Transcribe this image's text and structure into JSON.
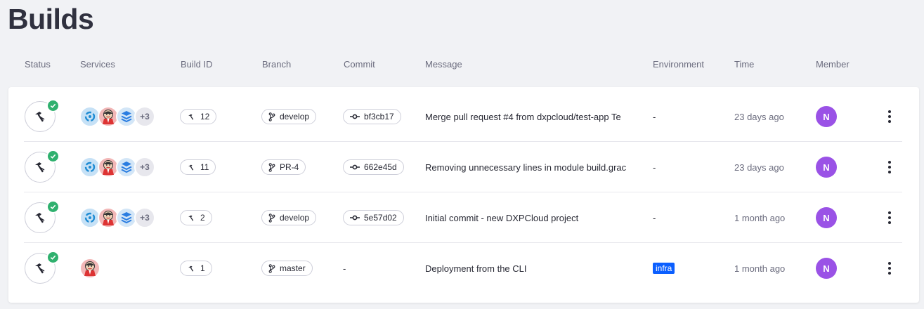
{
  "page": {
    "title": "Builds"
  },
  "columns": [
    "Status",
    "Services",
    "Build ID",
    "Branch",
    "Commit",
    "Message",
    "Environment",
    "Time",
    "Member"
  ],
  "colors": {
    "success": "#2fb06e",
    "avatar": "#9a52e6",
    "tag": "#0b5fff"
  },
  "builds": [
    {
      "status": "success",
      "services": [
        "liferay-icon",
        "jenkins-icon",
        "database-icon"
      ],
      "services_more": "+3",
      "build_id": "12",
      "branch": "develop",
      "commit": "bf3cb17",
      "message": "Merge pull request #4 from dxpcloud/test-app Te",
      "environment": "-",
      "time": "23 days ago",
      "member": "N"
    },
    {
      "status": "success",
      "services": [
        "liferay-icon",
        "jenkins-icon",
        "database-icon"
      ],
      "services_more": "+3",
      "build_id": "11",
      "branch": "PR-4",
      "commit": "662e45d",
      "message": "Removing unnecessary lines in module build.grac",
      "environment": "-",
      "time": "23 days ago",
      "member": "N"
    },
    {
      "status": "success",
      "services": [
        "liferay-icon",
        "jenkins-icon",
        "database-icon"
      ],
      "services_more": "+3",
      "build_id": "2",
      "branch": "develop",
      "commit": "5e57d02",
      "message": "Initial commit - new DXPCloud project",
      "environment": "-",
      "time": "1 month ago",
      "member": "N"
    },
    {
      "status": "success",
      "services": [
        "jenkins-icon"
      ],
      "services_more": "",
      "build_id": "1",
      "branch": "master",
      "commit": "-",
      "message": "Deployment from the CLI",
      "environment": "infra",
      "time": "1 month ago",
      "member": "N"
    }
  ]
}
